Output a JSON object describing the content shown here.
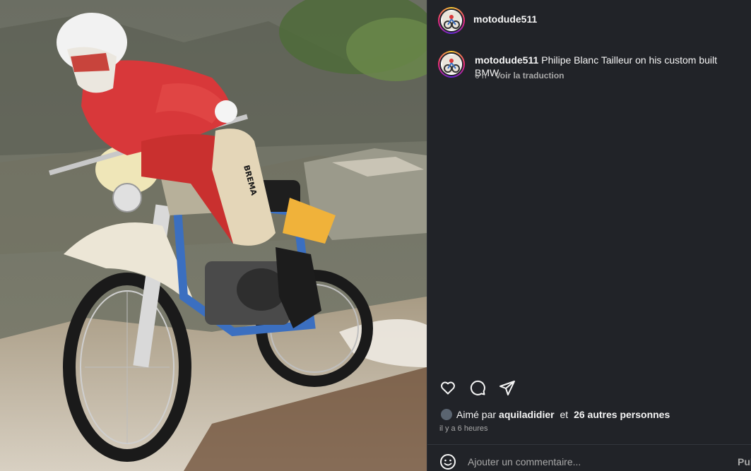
{
  "post": {
    "username": "motodude511",
    "caption": {
      "username": "motodude511",
      "text": "Philipe Blanc Tailleur on his custom built BMW",
      "age": "6 h",
      "translate": "Voir la traduction"
    },
    "likes": {
      "prefix": "Aimé par",
      "liker": "aquiladidier",
      "connector": " et ",
      "others": "26 autres personnes"
    },
    "time_ago": "il y a 6 heures",
    "comment": {
      "placeholder": "Ajouter un commentaire...",
      "post_label": "Publier"
    }
  },
  "photo": {
    "description_text": "BREMA"
  },
  "icons": {
    "like": "heart-icon",
    "comment": "comment-icon",
    "share": "share-icon",
    "emoji": "emoji-icon"
  },
  "colors": {
    "panel_bg": "#212328",
    "text_primary": "#f5f5f5",
    "text_secondary": "#a8a8a8",
    "avatar_ring": "#ee2a7b"
  }
}
